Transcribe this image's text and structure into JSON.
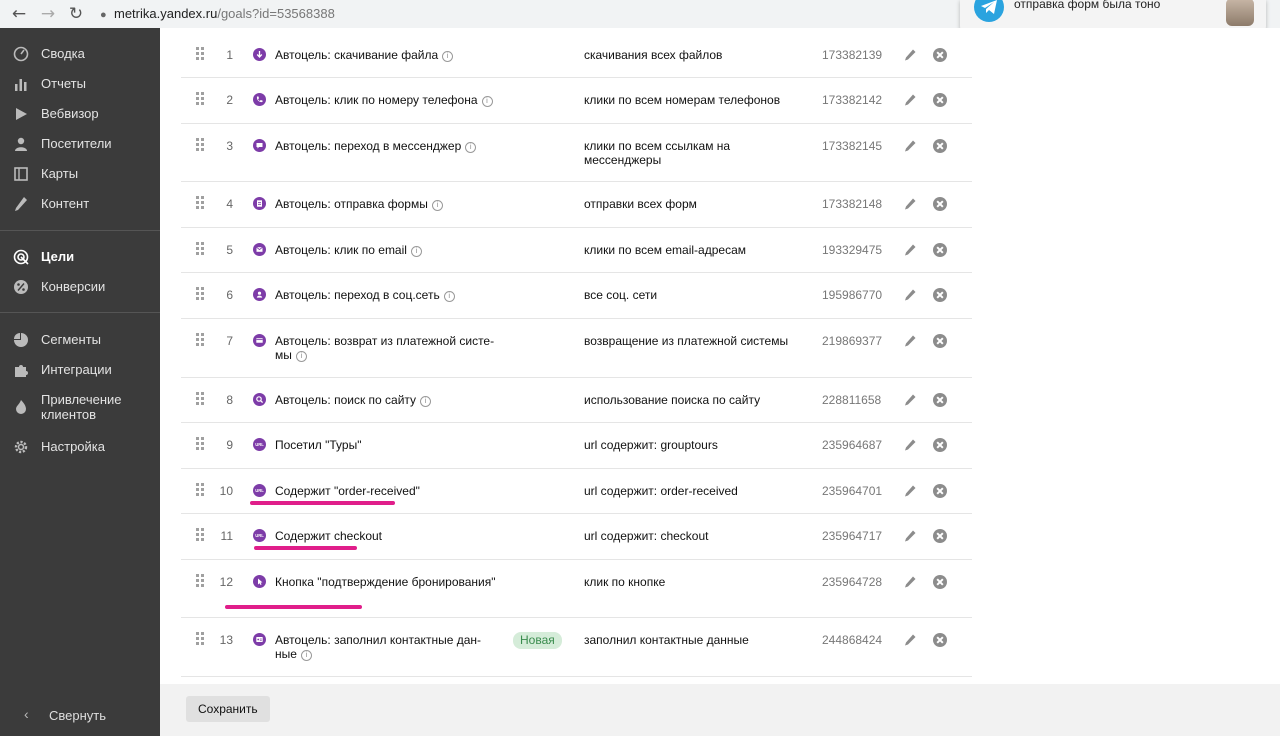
{
  "browser": {
    "back": "←",
    "forward": "→",
    "reload": "↻",
    "url_domain": "metrika.yandex.ru",
    "url_path": "/goals?id=53568388"
  },
  "notification": {
    "text": "отправка форм была тоно"
  },
  "sidebar": {
    "items": [
      {
        "label": "Сводка",
        "icon": "gauge-icon"
      },
      {
        "label": "Отчеты",
        "icon": "bar-chart-icon"
      },
      {
        "label": "Вебвизор",
        "icon": "play-icon"
      },
      {
        "label": "Посетители",
        "icon": "person-icon"
      },
      {
        "label": "Карты",
        "icon": "map-icon"
      },
      {
        "label": "Контент",
        "icon": "pencil-icon"
      },
      {
        "label": "Цели",
        "icon": "target-icon"
      },
      {
        "label": "Конверсии",
        "icon": "percent-icon"
      },
      {
        "label": "Сегменты",
        "icon": "pie-icon"
      },
      {
        "label": "Интеграции",
        "icon": "puzzle-icon"
      },
      {
        "label": "Привлечение клиентов",
        "icon": "flame-icon"
      },
      {
        "label": "Настройка",
        "icon": "gear-icon"
      }
    ],
    "collapse_label": "Свернуть",
    "collapse_icon": "chevron-left-icon"
  },
  "goals": [
    {
      "num": "1",
      "name": "Автоцель: скачивание файла",
      "info": true,
      "condition": "скачивания всех файлов",
      "id": "173382139",
      "icon": "download-icon"
    },
    {
      "num": "2",
      "name": "Автоцель: клик по номеру телефона",
      "info": true,
      "condition": "клики по всем номерам телефонов",
      "id": "173382142",
      "icon": "phone-icon"
    },
    {
      "num": "3",
      "name": "Автоцель: переход в мессенджер",
      "info": true,
      "condition": "клики по всем ссылкам на мессенджеры",
      "id": "173382145",
      "icon": "chat-icon"
    },
    {
      "num": "4",
      "name": "Автоцель: отправка формы",
      "info": true,
      "condition": "отправки всех форм",
      "id": "173382148",
      "icon": "form-icon"
    },
    {
      "num": "5",
      "name": "Автоцель: клик по email",
      "info": true,
      "condition": "клики по всем email-адресам",
      "id": "193329475",
      "icon": "mail-icon"
    },
    {
      "num": "6",
      "name": "Автоцель: переход в соц.сеть",
      "info": true,
      "condition": "все соц. сети",
      "id": "195986770",
      "icon": "social-icon"
    },
    {
      "num": "7",
      "name": "Автоцель: возврат из платежной систе-мы",
      "info": true,
      "condition": "возвращение из платежной системы",
      "id": "219869377",
      "icon": "payment-icon"
    },
    {
      "num": "8",
      "name": "Автоцель: поиск по сайту",
      "info": true,
      "condition": "использование поиска по сайту",
      "id": "228811658",
      "icon": "search-icon"
    },
    {
      "num": "9",
      "name": "Посетил \"Туры\"",
      "info": false,
      "condition": "url содержит: grouptours",
      "id": "235964687",
      "icon": "url-icon"
    },
    {
      "num": "10",
      "name": "Содержит \"order-received\"",
      "info": false,
      "condition": "url содержит: order-received",
      "id": "235964701",
      "icon": "url-icon"
    },
    {
      "num": "11",
      "name": "Содержит checkout",
      "info": false,
      "condition": "url содержит: checkout",
      "id": "235964717",
      "icon": "url-icon"
    },
    {
      "num": "12",
      "name": "Кнопка \"подтверждение бронирования\"",
      "info": false,
      "condition": "клик по кнопке",
      "id": "235964728",
      "icon": "click-icon"
    },
    {
      "num": "13",
      "name": "Автоцель: заполнил контактные дан-ные",
      "info": true,
      "badge": "Новая",
      "condition": "заполнил контактные данные",
      "id": "244868424",
      "icon": "contact-icon"
    }
  ],
  "footer": {
    "save_label": "Сохранить"
  },
  "colors": {
    "goal_icon": "#7d3ca8",
    "highlight": "#e01e8a",
    "badge_bg": "#d5ecd9",
    "sidebar_bg": "#3b3b3b"
  }
}
